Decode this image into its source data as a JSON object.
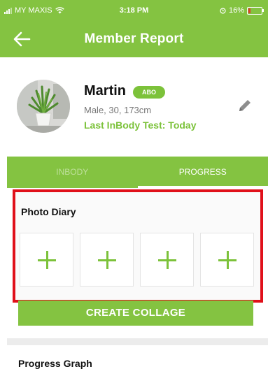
{
  "status_bar": {
    "carrier": "MY MAXIS",
    "time": "3:18 PM",
    "battery": "16%"
  },
  "header": {
    "title": "Member Report",
    "back_icon": "arrow-left-icon"
  },
  "profile": {
    "name": "Martin",
    "badge": "ABO",
    "details": "Male, 30, 173cm",
    "last_test": "Last InBody Test: Today",
    "edit_icon": "pencil-icon"
  },
  "tabs": [
    {
      "label": "INBODY",
      "active": false
    },
    {
      "label": "PROGRESS",
      "active": true
    }
  ],
  "photo_diary": {
    "title": "Photo Diary",
    "slot_icon": "plus-icon"
  },
  "create_collage_label": "CREATE COLLAGE",
  "next_section_title": "Progress Graph",
  "colors": {
    "brand_green": "#84c341",
    "highlight_red": "#e0101a"
  }
}
